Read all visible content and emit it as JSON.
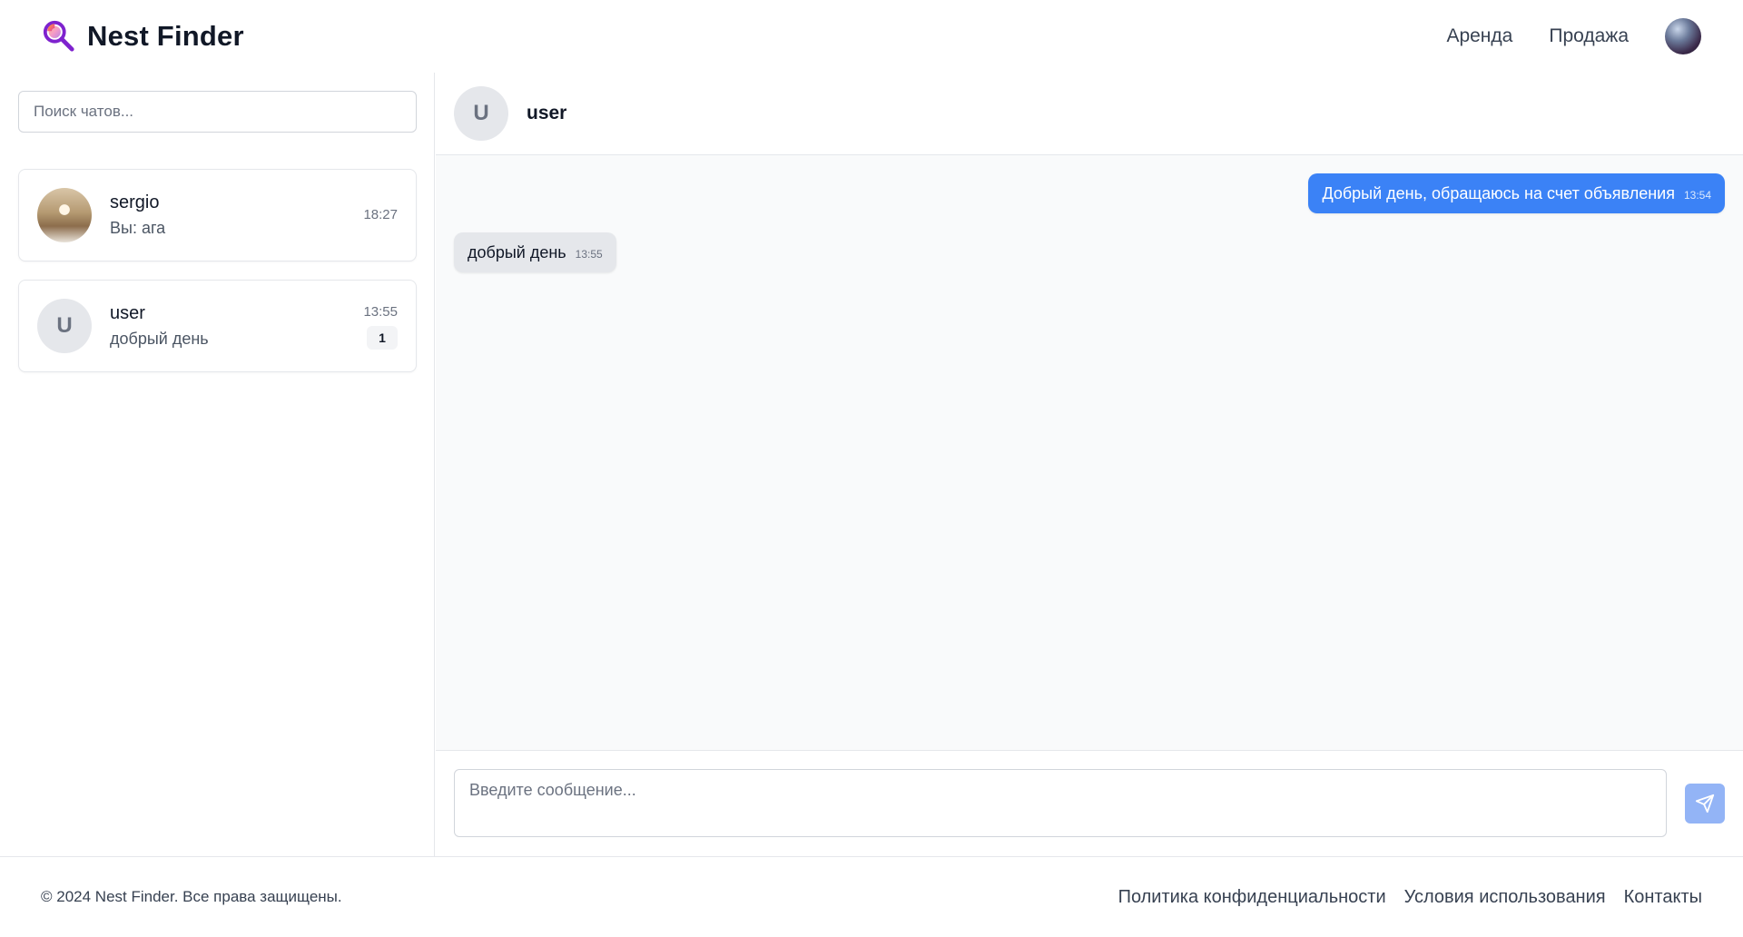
{
  "header": {
    "brand": "Nest Finder",
    "nav": [
      "Аренда",
      "Продажа"
    ]
  },
  "sidebar": {
    "search_placeholder": "Поиск чатов...",
    "chats": [
      {
        "name": "sergio",
        "last_message": "Вы: ага",
        "time": "18:27",
        "avatar": "photo"
      },
      {
        "name": "user",
        "last_message": "добрый день",
        "time": "13:55",
        "avatar_letter": "U",
        "unread": "1"
      }
    ]
  },
  "chat": {
    "title": "user",
    "avatar_letter": "U",
    "messages": [
      {
        "direction": "out",
        "text": "Добрый день, обращаюсь на счет объявления",
        "time": "13:54"
      },
      {
        "direction": "in",
        "text": "добрый день",
        "time": "13:55"
      }
    ],
    "input_placeholder": "Введите сообщение..."
  },
  "footer": {
    "copyright": "© 2024 Nest Finder. Все права защищены.",
    "links": [
      "Политика конфиденциальности",
      "Условия использования",
      "Контакты"
    ]
  },
  "colors": {
    "accent": "#3b82f6",
    "brand_icon": "#9333ea",
    "send_button": "#93b4f6"
  }
}
